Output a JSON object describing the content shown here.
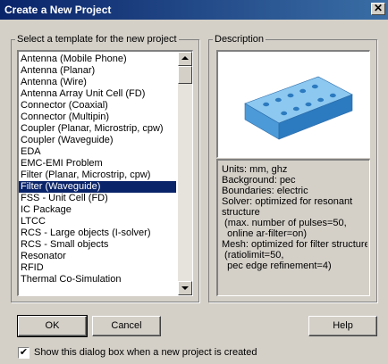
{
  "window": {
    "title": "Create a New Project",
    "close_glyph": "✕"
  },
  "template_group": {
    "legend": "Select a template for the new project",
    "items": [
      "Antenna (Mobile Phone)",
      "Antenna (Planar)",
      "Antenna (Wire)",
      "Antenna Array Unit Cell (FD)",
      "Connector (Coaxial)",
      "Connector (Multipin)",
      "Coupler (Planar, Microstrip, cpw)",
      "Coupler (Waveguide)",
      "EDA",
      "EMC-EMI Problem",
      "Filter (Planar, Microstrip, cpw)",
      "Filter (Waveguide)",
      "FSS - Unit Cell (FD)",
      "IC Package",
      "LTCC",
      "RCS - Large objects (I-solver)",
      "RCS - Small objects",
      "Resonator",
      "RFID",
      "Thermal Co-Simulation"
    ],
    "selected_index": 11
  },
  "description_group": {
    "legend": "Description",
    "lines": [
      "Units: mm, ghz",
      "Background: pec",
      "Boundaries: electric",
      "Solver: optimized for resonant",
      "structure",
      " (max. number of pulses=50,",
      "  online ar-filter=on)",
      "Mesh: optimized for filter structure",
      " (ratiolimit=50,",
      "  pec edge refinement=4)"
    ],
    "preview_colors": {
      "top": "#8cc8f0",
      "front": "#4c9ad8",
      "side": "#2c7abf"
    }
  },
  "buttons": {
    "ok": "OK",
    "cancel": "Cancel",
    "help": "Help"
  },
  "checkbox": {
    "label": "Show this dialog box when a new project is created",
    "checked": true,
    "check_glyph": "✔"
  }
}
